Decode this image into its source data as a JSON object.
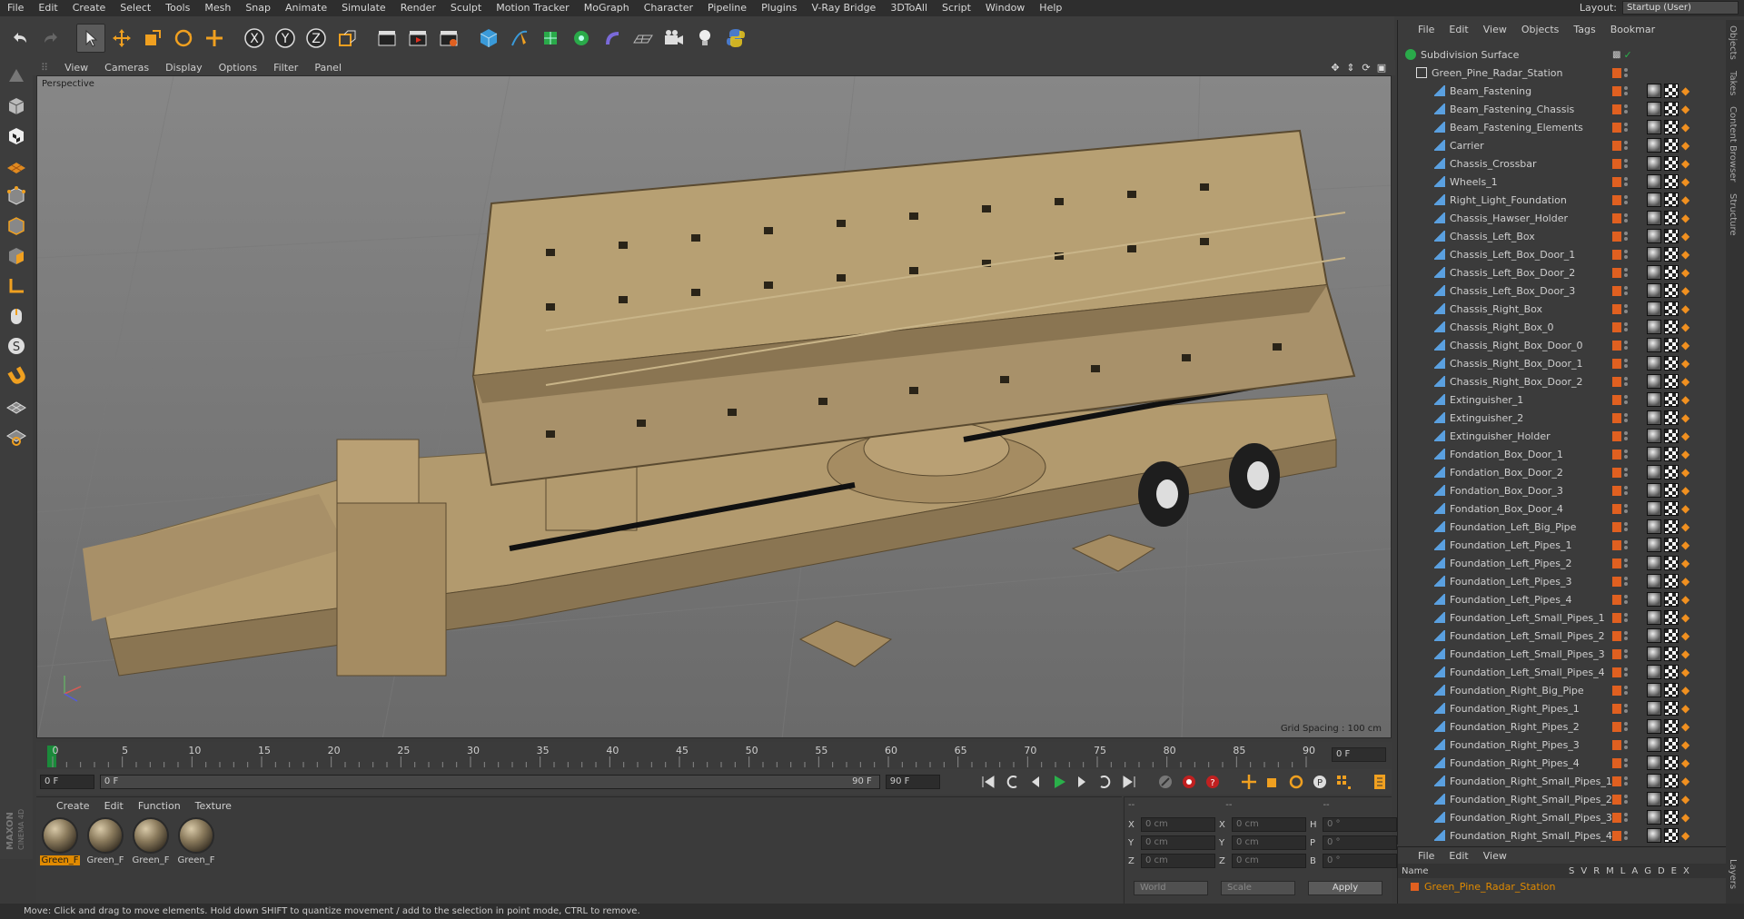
{
  "menubar": {
    "items": [
      "File",
      "Edit",
      "Create",
      "Select",
      "Tools",
      "Mesh",
      "Snap",
      "Animate",
      "Simulate",
      "Render",
      "Sculpt",
      "Motion Tracker",
      "MoGraph",
      "Character",
      "Pipeline",
      "Plugins",
      "V-Ray Bridge",
      "3DToAll",
      "Script",
      "Window",
      "Help"
    ],
    "layout_label": "Layout:",
    "layout_value": "Startup (User)"
  },
  "viewport": {
    "menu": [
      "View",
      "Cameras",
      "Display",
      "Options",
      "Filter",
      "Panel"
    ],
    "label": "Perspective",
    "grid_spacing": "Grid Spacing : 100 cm"
  },
  "timeline": {
    "ticks": [
      "0",
      "5",
      "10",
      "15",
      "20",
      "25",
      "30",
      "35",
      "40",
      "45",
      "50",
      "55",
      "60",
      "65",
      "70",
      "75",
      "80",
      "85",
      "90"
    ],
    "current_frame": "0 F"
  },
  "transport": {
    "start_field": "0 F",
    "range_start": "0 F",
    "range_end": "90 F",
    "end_field": "90 F"
  },
  "materials": {
    "menu": [
      "Create",
      "Edit",
      "Function",
      "Texture"
    ],
    "items": [
      "Green_F",
      "Green_F",
      "Green_F",
      "Green_F"
    ]
  },
  "coords": {
    "header": [
      "--",
      "--",
      "--"
    ],
    "rows": [
      {
        "a": "X",
        "av": "0 cm",
        "b": "X",
        "bv": "0 cm",
        "c": "H",
        "cv": "0 °"
      },
      {
        "a": "Y",
        "av": "0 cm",
        "b": "Y",
        "bv": "0 cm",
        "c": "P",
        "cv": "0 °"
      },
      {
        "a": "Z",
        "av": "0 cm",
        "b": "Z",
        "bv": "0 cm",
        "c": "B",
        "cv": "0 °"
      }
    ],
    "world": "World",
    "scale": "Scale",
    "apply": "Apply"
  },
  "objects": {
    "menu": [
      "File",
      "Edit",
      "View",
      "Objects",
      "Tags",
      "Bookmar"
    ],
    "items": [
      "Subdivision Surface",
      "Green_Pine_Radar_Station",
      "Beam_Fastening",
      "Beam_Fastening_Chassis",
      "Beam_Fastening_Elements",
      "Carrier",
      "Chassis_Crossbar",
      "Wheels_1",
      "Right_Light_Foundation",
      "Chassis_Hawser_Holder",
      "Chassis_Left_Box",
      "Chassis_Left_Box_Door_1",
      "Chassis_Left_Box_Door_2",
      "Chassis_Left_Box_Door_3",
      "Chassis_Right_Box",
      "Chassis_Right_Box_0",
      "Chassis_Right_Box_Door_0",
      "Chassis_Right_Box_Door_1",
      "Chassis_Right_Box_Door_2",
      "Extinguisher_1",
      "Extinguisher_2",
      "Extinguisher_Holder",
      "Fondation_Box_Door_1",
      "Fondation_Box_Door_2",
      "Fondation_Box_Door_3",
      "Fondation_Box_Door_4",
      "Foundation_Left_Big_Pipe",
      "Foundation_Left_Pipes_1",
      "Foundation_Left_Pipes_2",
      "Foundation_Left_Pipes_3",
      "Foundation_Left_Pipes_4",
      "Foundation_Left_Small_Pipes_1",
      "Foundation_Left_Small_Pipes_2",
      "Foundation_Left_Small_Pipes_3",
      "Foundation_Left_Small_Pipes_4",
      "Foundation_Right_Big_Pipe",
      "Foundation_Right_Pipes_1",
      "Foundation_Right_Pipes_2",
      "Foundation_Right_Pipes_3",
      "Foundation_Right_Pipes_4",
      "Foundation_Right_Small_Pipes_1",
      "Foundation_Right_Small_Pipes_2",
      "Foundation_Right_Small_Pipes_3",
      "Foundation_Right_Small_Pipes_4"
    ]
  },
  "layers": {
    "menu": [
      "File",
      "Edit",
      "View"
    ],
    "head_name": "Name",
    "head_cols": [
      "S",
      "V",
      "R",
      "M",
      "L",
      "A",
      "G",
      "D",
      "E",
      "X"
    ],
    "row": "Green_Pine_Radar_Station"
  },
  "side_tabs": [
    "Objects",
    "Takes",
    "Content Browser",
    "Structure",
    "Layers"
  ],
  "status": "Move: Click and drag to move elements. Hold down SHIFT to quantize movement / add to the selection in point mode, CTRL to remove.",
  "colors": {
    "accent": "#e08a00",
    "tag_orange": "#f09020"
  }
}
